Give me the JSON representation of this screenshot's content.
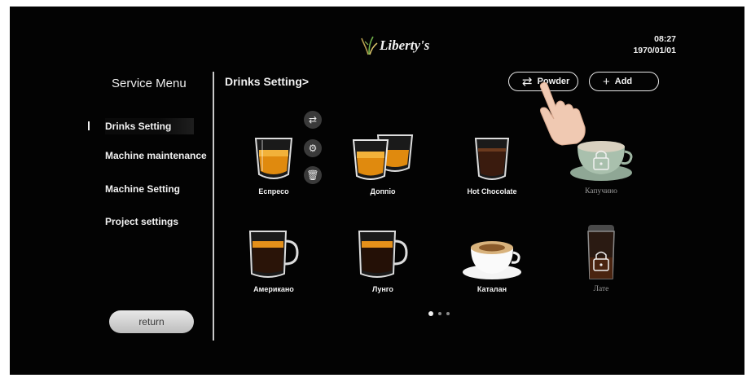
{
  "header": {
    "logo_text": "Liberty's",
    "time": "08:27",
    "date": "1970/01/01"
  },
  "sidebar": {
    "title": "Service Menu",
    "items": [
      {
        "label": "Drinks Setting",
        "active": true
      },
      {
        "label": "Machine maintenance",
        "active": false
      },
      {
        "label": "Machine Setting",
        "active": false
      },
      {
        "label": "Project settings",
        "active": false
      }
    ],
    "return_label": "return"
  },
  "main": {
    "title": "Drinks Setting>",
    "powder_label": "Powder",
    "powder_icon": "swap-arrows-icon",
    "add_label": "Add",
    "add_icon": "plus-icon",
    "side_actions": [
      "swap-icon",
      "gear-icon",
      "trash-icon"
    ],
    "drinks": [
      {
        "label": "Еспресо",
        "icon": "espresso-glass-icon",
        "locked": false
      },
      {
        "label": "Доппіо",
        "icon": "doppio-glasses-icon",
        "locked": false
      },
      {
        "label": "Hot Chocolate",
        "icon": "hot-chocolate-glass-icon",
        "locked": false
      },
      {
        "label": "Капучино",
        "icon": "cappuccino-cup-icon",
        "locked": true
      },
      {
        "label": "Американо",
        "icon": "americano-mug-icon",
        "locked": false
      },
      {
        "label": "Лунго",
        "icon": "lungo-mug-icon",
        "locked": false
      },
      {
        "label": "Каталан",
        "icon": "catalan-cup-icon",
        "locked": false
      },
      {
        "label": "Лате",
        "icon": "latte-glass-icon",
        "locked": true
      }
    ],
    "page_dots": {
      "count": 3,
      "active": 1
    }
  },
  "colors": {
    "background": "#030303",
    "text": "#f2f2f2",
    "coffee": "#d98a10",
    "locked_text": "#9a9a9a"
  }
}
